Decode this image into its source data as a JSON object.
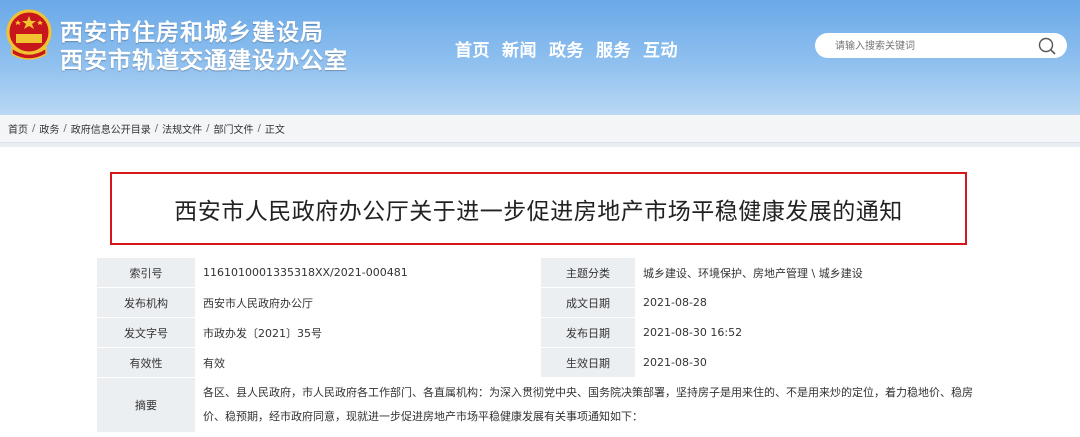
{
  "header": {
    "org_name_1": "西安市住房和城乡建设局",
    "org_name_2": "西安市轨道交通建设办公室",
    "nav": [
      "首页",
      "新闻",
      "政务",
      "服务",
      "互动"
    ],
    "search_placeholder": "请输入搜索关键词",
    "emblem_icon": "national-emblem-icon",
    "search_icon": "search-icon"
  },
  "breadcrumb": [
    "首页",
    "政务",
    "政府信息公开目录",
    "法规文件",
    "部门文件",
    "正文"
  ],
  "document": {
    "title": "西安市人民政府办公厅关于进一步促进房地产市场平稳健康发展的通知",
    "meta": [
      {
        "label": "索引号",
        "value": "1161010001335318XX/2021-000481",
        "label2": "主题分类",
        "value2": "城乡建设、环境保护、房地产管理 \\ 城乡建设"
      },
      {
        "label": "发布机构",
        "value": "西安市人民政府办公厅",
        "label2": "成文日期",
        "value2": "2021-08-28"
      },
      {
        "label": "发文字号",
        "value": "市政办发〔2021〕35号",
        "label2": "发布日期",
        "value2": "2021-08-30 16:52"
      },
      {
        "label": "有效性",
        "value": "有效",
        "label2": "生效日期",
        "value2": "2021-08-30"
      }
    ],
    "abstract_label": "摘要",
    "abstract": "各区、县人民政府，市人民政府各工作部门、各直属机构：为深入贯彻党中央、国务院决策部署，坚持房子是用来住的、不是用来炒的定位，着力稳地价、稳房价、稳预期，经市政府同意，现就进一步促进房地产市场平稳健康发展有关事项通知如下："
  },
  "colors": {
    "header_blue": "#6aa9e8",
    "title_border": "#d7161b",
    "label_bg": "#eceff2"
  }
}
